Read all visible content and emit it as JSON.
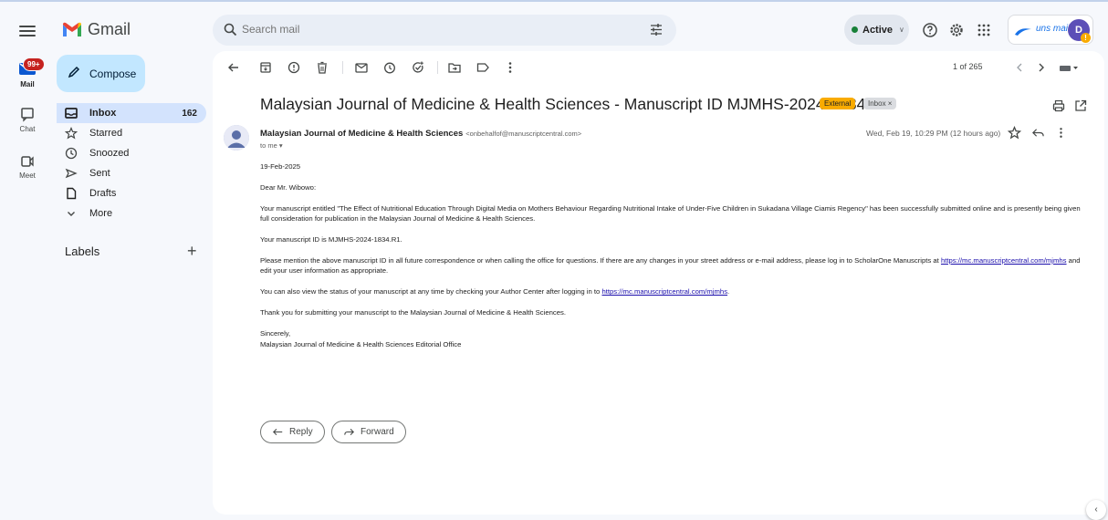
{
  "app": {
    "name": "Gmail"
  },
  "rail": {
    "mail_label": "Mail",
    "mail_badge": "99+",
    "chat_label": "Chat",
    "meet_label": "Meet"
  },
  "search": {
    "placeholder": "Search mail"
  },
  "header": {
    "status": "Active",
    "account_brand": "uns mail",
    "avatar_initial": "D",
    "avatar_warning": "!"
  },
  "sidebar": {
    "compose_label": "Compose",
    "items": [
      {
        "label": "Inbox",
        "count": "162",
        "icon": "inbox-icon"
      },
      {
        "label": "Starred",
        "count": "",
        "icon": "star-icon"
      },
      {
        "label": "Snoozed",
        "count": "",
        "icon": "clock-icon"
      },
      {
        "label": "Sent",
        "count": "",
        "icon": "send-icon"
      },
      {
        "label": "Drafts",
        "count": "",
        "icon": "draft-icon"
      },
      {
        "label": "More",
        "count": "",
        "icon": "chevron-down-icon"
      }
    ],
    "labels_title": "Labels",
    "labels_add": "+"
  },
  "toolbar": {
    "pager": "1 of 265"
  },
  "email": {
    "subject": "Malaysian Journal of Medicine & Health Sciences - Manuscript ID MJMHS-2024-1834.R1",
    "tag_external": "External",
    "tag_inbox": "Inbox ×",
    "sender_name": "Malaysian Journal of Medicine & Health Sciences",
    "sender_email": "<onbehalfof@manuscriptcentral.com>",
    "to": "to me ▾",
    "date": "Wed, Feb 19, 10:29 PM (12 hours ago)",
    "body": {
      "date_line": "19-Feb-2025",
      "greeting": "Dear Mr. Wibowo:",
      "p1": "Your manuscript entitled \"The Effect of Nutritional Education Through Digital Media on Mothers Behaviour Regarding Nutritional Intake of Under-Five Children in Sukadana Village Ciamis Regency\" has been successfully submitted online and is presently being given full consideration for publication in the Malaysian Journal of Medicine & Health Sciences.",
      "p2": "Your manuscript ID is MJMHS-2024-1834.R1.",
      "p3_a": "Please mention the above manuscript ID in all future correspondence or when calling the office for questions. If there are any changes in your street address or e-mail address, please log in to ScholarOne Manuscripts at",
      "p3_link": "https://mc.manuscriptcentral.com/mjmhs",
      "p3_b": "and edit your user information as appropriate.",
      "p4_a": "You can also view the status of your manuscript at any time by checking your Author Center after logging in to",
      "p4_link": "https://mc.manuscriptcentral.com/mjmhs",
      "p4_b": ".",
      "p5": "Thank you for submitting your manuscript to the Malaysian Journal of Medicine & Health Sciences.",
      "closing": "Sincerely,",
      "signature": "Malaysian Journal of Medicine & Health Sciences Editorial Office"
    },
    "reply_label": "Reply",
    "forward_label": "Forward"
  },
  "colors": {
    "background": "#f6f8fc",
    "compose": "#c2e7ff",
    "inbox_active": "#d3e3fd",
    "external_tag": "#f9ab00",
    "link": "#1a0dab",
    "status_dot": "#188038",
    "badge": "#c5221f"
  }
}
